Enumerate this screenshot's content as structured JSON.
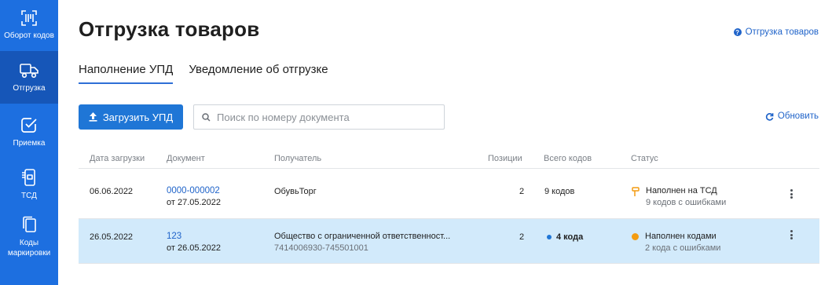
{
  "sidebar": {
    "items": [
      {
        "label": "Оборот кодов",
        "icon": "barcode-scan-icon"
      },
      {
        "label": "Отгрузка",
        "icon": "truck-icon",
        "active": true
      },
      {
        "label": "Приемка",
        "icon": "checkbox-icon"
      },
      {
        "label": "ТСД",
        "icon": "handheld-scanner-icon"
      },
      {
        "label": "Коды\nмаркировки",
        "icon": "copy-codes-icon"
      }
    ]
  },
  "header": {
    "title": "Отгрузка товаров",
    "help_link": "Отгрузка товаров"
  },
  "tabs": [
    {
      "label": "Наполнение УПД",
      "active": true
    },
    {
      "label": "Уведомление об отгрузке",
      "active": false
    }
  ],
  "toolbar": {
    "upload_label": "Загрузить УПД",
    "search_placeholder": "Поиск по номеру документа",
    "refresh_label": "Обновить"
  },
  "table": {
    "columns": [
      "Дата загрузки",
      "Документ",
      "Получатель",
      "Позиции",
      "Всего кодов",
      "Статус"
    ],
    "rows": [
      {
        "date": "06.06.2022",
        "doc_number": "0000-000002",
        "doc_date": "от 27.05.2022",
        "recipient": "ОбувьТорг",
        "recipient_inn": "",
        "positions": "2",
        "codes": "9 кодов",
        "codes_dot": false,
        "status": "Наполнен на ТСД",
        "status_sub": "9 кодов с ошибками",
        "status_icon": "scanner-icon"
      },
      {
        "date": "26.05.2022",
        "doc_number": "123",
        "doc_date": "от 26.05.2022",
        "recipient": "Общество с ограниченной ответственност...",
        "recipient_inn": "7414006930-745501001",
        "positions": "2",
        "codes": "4 кода",
        "codes_dot": true,
        "status": "Наполнен кодами",
        "status_sub": "2 кода с ошибками",
        "status_icon": "orange-dot"
      }
    ]
  },
  "colors": {
    "sidebar": "#1d6fe0",
    "accent": "#1f76d6",
    "link": "#1f63c9",
    "selected_row": "#d2eafb",
    "status_orange": "#f39c12",
    "codes_dot": "#1f76d6"
  }
}
